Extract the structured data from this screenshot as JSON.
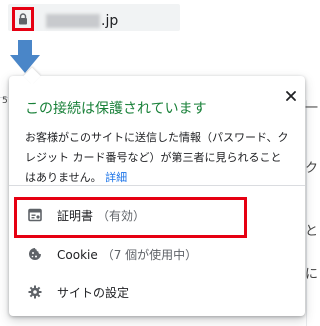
{
  "address_bar": {
    "domain_suffix": ".jp",
    "lock_icon": "lock-icon"
  },
  "annotation": {
    "highlight_color": "#e60012",
    "arrow_color": "#4a86c8"
  },
  "background": {
    "left_glyph": "5",
    "right_glyph_1": "一",
    "right_glyph_2": "ク",
    "right_glyph_3": "と",
    "right_glyph_4": "に"
  },
  "popup": {
    "title": "この接続は保護されています",
    "title_color": "#188038",
    "close_icon": "close-icon",
    "description": "お客様がこのサイトに送信した情報（パスワード、クレジット カード番号など）が第三者に見られることはありません。",
    "details_link": "詳細",
    "items": [
      {
        "icon": "certificate-icon",
        "label": "証明書",
        "sub": "（有効）"
      },
      {
        "icon": "cookie-icon",
        "label": "Cookie",
        "sub": "（7 個が使用中）"
      },
      {
        "icon": "gear-icon",
        "label": "サイトの設定",
        "sub": ""
      }
    ]
  }
}
